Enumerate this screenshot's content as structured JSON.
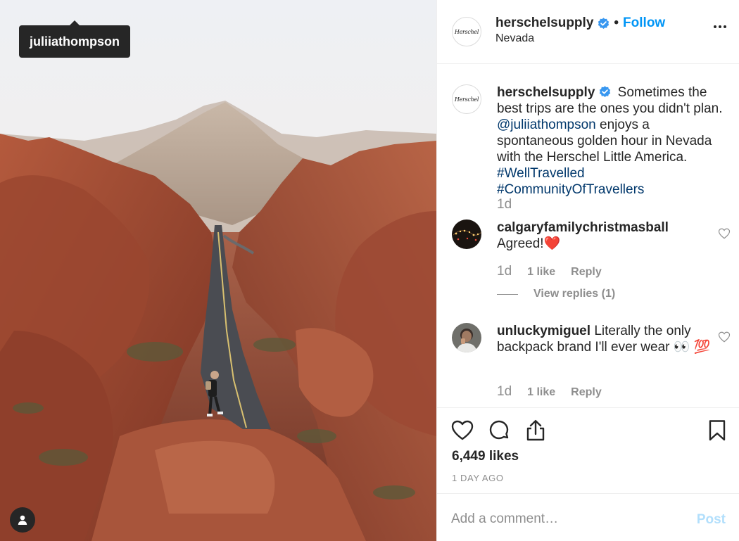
{
  "photo": {
    "tagged_user": "juliiathompson"
  },
  "header": {
    "username": "herschelsupply",
    "separator": "•",
    "follow_label": "Follow",
    "location": "Nevada",
    "brand_logo_text": "Herschel"
  },
  "caption": {
    "username": "herschelsupply",
    "text_1": "Sometimes the best trips are the ones you didn't plan.",
    "mention": "@juliiathompson",
    "text_2": "enjoys a spontaneous golden hour in Nevada with the Herschel Little America.",
    "hashtag_1": "#WellTravelled",
    "hashtag_2": "#CommunityOfTravellers",
    "time": "1d"
  },
  "comments": [
    {
      "username": "calgaryfamilychristmasball",
      "text": "Agreed!❤️",
      "time": "1d",
      "likes": "1 like",
      "reply_label": "Reply",
      "view_replies": "View replies (1)"
    },
    {
      "username": "unluckymiguel",
      "text": "Literally the only backpack brand I'll ever wear 👀 💯",
      "time": "1d",
      "likes": "1 like",
      "reply_label": "Reply"
    }
  ],
  "actions": {
    "likes_count": "6,449 likes",
    "post_time": "1 DAY AGO"
  },
  "comment_box": {
    "placeholder": "Add a comment…",
    "post_label": "Post"
  },
  "colors": {
    "link_blue": "#0095f6",
    "hashtag": "#00376b",
    "muted": "#8e8e8e",
    "post_disabled": "#b2dffc",
    "verified": "#3897f0"
  },
  "icons": [
    "verified-badge-icon",
    "more-options-icon",
    "heart-icon",
    "comment-icon",
    "share-icon",
    "bookmark-icon",
    "user-tag-icon"
  ]
}
